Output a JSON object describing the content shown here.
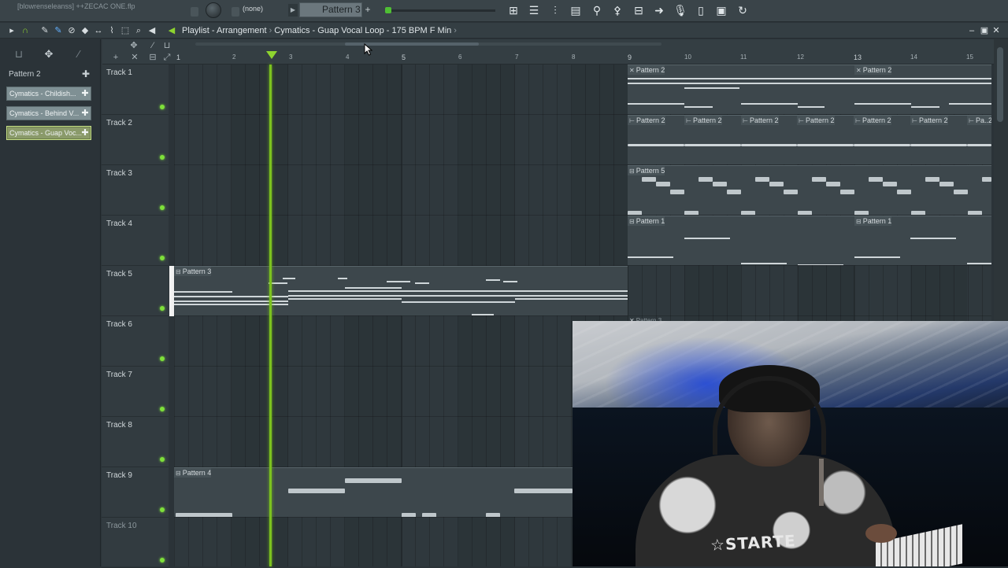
{
  "app": {
    "file_title": "[blowrenseleanss] ++ZECAC ONE.flp",
    "pattern_selector": "Pattern 3",
    "none_label": "(none)"
  },
  "breadcrumb": {
    "part1": "Playlist - Arrangement",
    "part2": "Cymatics - Guap Vocal Loop - 175 BPM F Min"
  },
  "picker": {
    "header": "Pattern 2",
    "clips": [
      "Cymatics - Childish...",
      "Cymatics - Behind V...",
      "Cymatics - Guap Voc..."
    ]
  },
  "tracks": [
    "Track 1",
    "Track 2",
    "Track 3",
    "Track 4",
    "Track 5",
    "Track 6",
    "Track 7",
    "Track 8",
    "Track 9",
    "Track 10"
  ],
  "bars": [
    "1",
    "2",
    "3",
    "4",
    "5",
    "6",
    "7",
    "8",
    "9",
    "10",
    "11",
    "12",
    "13",
    "14",
    "15"
  ],
  "clip_labels": {
    "p2": "Pattern 2",
    "p2_short": "Pa..2",
    "p5": "Pattern 5",
    "p1": "Pattern 1",
    "p3": "Pattern 3",
    "p4": "Pattern 4"
  },
  "colors": {
    "accent": "#7cc21f",
    "track_led": "#7ee03a",
    "active_clip_border": "#c7e08a"
  },
  "icons": {
    "toolbar": [
      "piano-roll-icon",
      "channel-rack-icon",
      "mixer-icon",
      "playlist-icon",
      "plugin-icon",
      "browser-icon",
      "pattern-icon",
      "export-icon",
      "record-mic-icon",
      "template-icon",
      "stamp-icon",
      "refresh-icon"
    ]
  }
}
